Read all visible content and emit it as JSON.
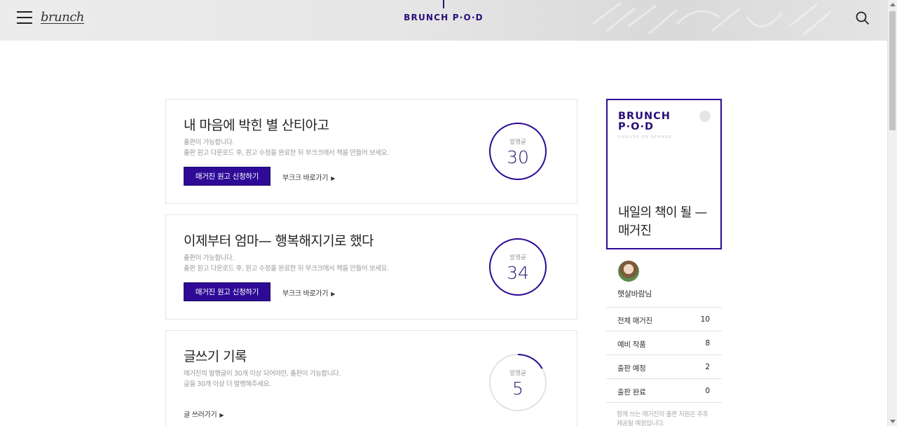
{
  "header": {
    "logo": "brunch",
    "title": "BRUNCH P·O·D"
  },
  "colors": {
    "accent": "#2e0a96",
    "brand_text": "#2a0f7a",
    "progress_track": "#e2e2e2"
  },
  "cards": [
    {
      "title": "내 마음에 박힌 별 산티아고",
      "desc_line1": "출판이 가능합니다.",
      "desc_line2": "출판 원고 다운로드 후, 원고 수정을 완료한 뒤 부크크에서 책을 만들어 보세요.",
      "apply_label": "매거진 원고 신청하기",
      "link_label": "부크크 바로가기",
      "circle_label": "발행글",
      "count": "30",
      "progress": 1.0
    },
    {
      "title": "이제부터 엄마— 행복해지기로 했다",
      "desc_line1": "출판이 가능합니다.",
      "desc_line2": "출판 원고 다운로드 후, 원고 수정을 완료한 뒤 부크크에서 책을 만들어 보세요.",
      "apply_label": "매거진 원고 신청하기",
      "link_label": "부크크 바로가기",
      "circle_label": "발행글",
      "count": "34",
      "progress": 1.0
    },
    {
      "title": "글쓰기 기록",
      "desc_line1": "매거진의 발행글이 30개 이상 되어야만, 출판이 가능합니다.",
      "desc_line2": "글을 30개 이상 더 발행해주세요.",
      "write_label": "글 쓰러가기",
      "circle_label": "발행글",
      "count": "5",
      "progress": 0.167
    }
  ],
  "sidebar": {
    "brand_line1": "BRUNCH",
    "brand_line2": "P·O·D",
    "brand_sub": "PUBLISH ON DEMAND",
    "headline": "내일의 책이 될 — 매거진",
    "username": "햇살바람님",
    "stats": [
      {
        "label": "전체 매거진",
        "value": "10"
      },
      {
        "label": "예비 작품",
        "value": "8"
      },
      {
        "label": "출판 예정",
        "value": "2"
      },
      {
        "label": "출판 완료",
        "value": "0"
      }
    ],
    "note": "함께 쓰는 매거진의 출판 지원은 추후 제공될 예정입니다."
  }
}
